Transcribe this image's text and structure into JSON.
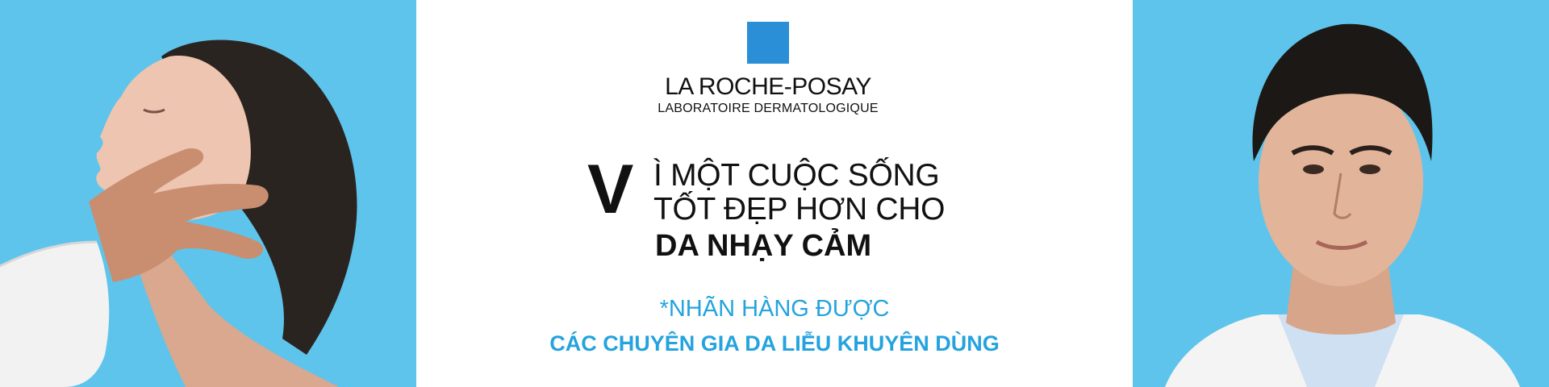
{
  "brand": {
    "name": "LA ROCHE-POSAY",
    "subtitle": "LABORATOIRE DERMATOLOGIQUE",
    "logo_color": "#2a8fd6"
  },
  "headline": {
    "initial": "V",
    "line1": "Ì MỘT CUỘC SỐNG",
    "line2": "TỐT ĐẸP HƠN CHO",
    "line3": "DA NHẠY CẢM"
  },
  "claim": {
    "line1": "*NHÃN HÀNG ĐƯỢC",
    "line2": "CÁC CHUYÊN GIA DA LIỄU KHUYÊN DÙNG",
    "color": "#24a3de"
  },
  "colors": {
    "panel_background": "#5ec4ec",
    "center_background": "#ffffff",
    "text": "#111111"
  }
}
